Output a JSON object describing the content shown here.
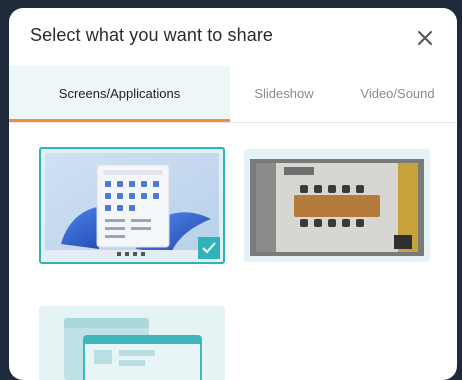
{
  "dialog": {
    "title": "Select what you want to share",
    "close_icon": "close-icon"
  },
  "tabs": [
    {
      "label": "Screens/Applications",
      "active": true
    },
    {
      "label": "Slideshow",
      "active": false
    },
    {
      "label": "Video/Sound",
      "active": false
    }
  ],
  "tiles": [
    {
      "name": "screen-1",
      "selected": true
    },
    {
      "name": "screen-2",
      "selected": false
    },
    {
      "name": "application-window",
      "selected": false
    }
  ],
  "colors": {
    "accent": "#2fb3b8",
    "tab_underline": "#e8923a",
    "active_tab_bg": "#edf7f8"
  }
}
